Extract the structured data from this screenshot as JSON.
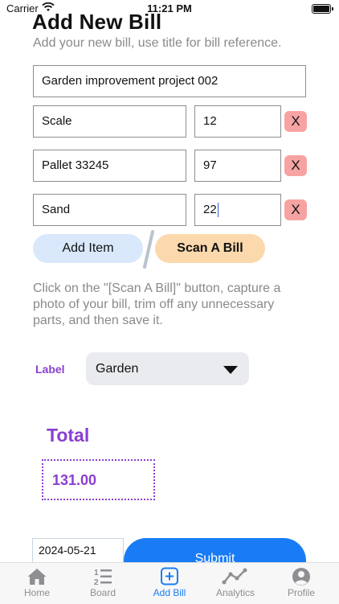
{
  "status": {
    "carrier": "Carrier",
    "time": "11:21 PM"
  },
  "header": {
    "title": "Add New Bill",
    "subtitle": "Add your new bill, use title for bill reference."
  },
  "form": {
    "bill_title": "Garden improvement project 002",
    "items": [
      {
        "name": "Scale",
        "amount": "12",
        "remove_label": "X"
      },
      {
        "name": "Pallet 33245",
        "amount": "97",
        "remove_label": "X"
      },
      {
        "name": "Sand",
        "amount": "22",
        "remove_label": "X"
      }
    ],
    "add_item_label": "Add Item",
    "scan_bill_label": "Scan A Bill",
    "help_text": "Click on the \"[Scan A Bill]\" button, capture a photo of your bill, trim off any unnecessary parts, and then save it.",
    "label_caption": "Label",
    "label_value": "Garden",
    "total_caption": "Total",
    "total_value": "131.00",
    "date_value": "2024-05-21",
    "submit_label": "Submit"
  },
  "tabs": [
    {
      "label": "Home",
      "icon": "home-icon",
      "active": false
    },
    {
      "label": "Board",
      "icon": "list-numbered-icon",
      "active": false
    },
    {
      "label": "Add Bill",
      "icon": "plus-square-icon",
      "active": true
    },
    {
      "label": "Analytics",
      "icon": "line-chart-icon",
      "active": false
    },
    {
      "label": "Profile",
      "icon": "person-circle-icon",
      "active": false
    }
  ],
  "colors": {
    "accent": "#1a7cf5",
    "purple": "#8b3fd1",
    "danger_bg": "#f7a3a3",
    "scan_bg": "#fbd9ad",
    "add_bg": "#d9e8fb"
  }
}
